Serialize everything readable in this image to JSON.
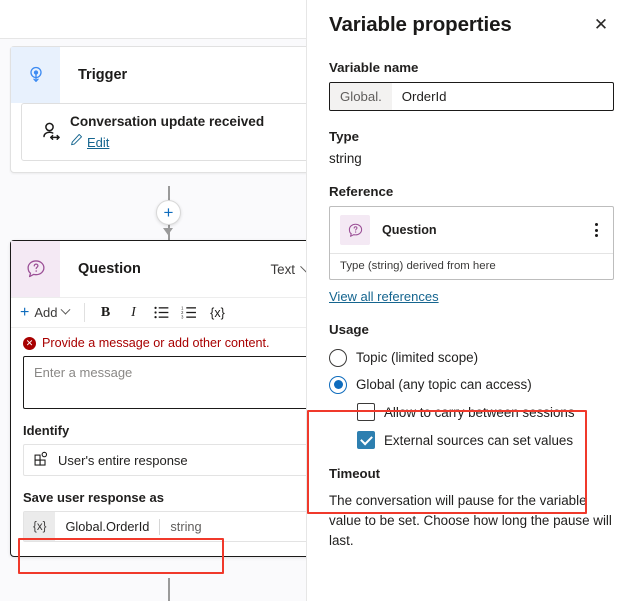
{
  "canvas": {
    "trigger_node": {
      "icon": "trigger-bolt-icon",
      "title": "Trigger",
      "item": {
        "icon": "conversation-update-icon",
        "title": "Conversation update received",
        "edit_icon": "pencil-icon",
        "edit_label": "Edit"
      }
    },
    "add_node_button": "+",
    "question_node": {
      "icon": "question-bubble-icon",
      "title": "Question",
      "type_selector": {
        "value": "Text",
        "chevron": "chevron-down-icon"
      },
      "toolbar": {
        "add_label": "Add",
        "add_plus_icon": "plus-icon",
        "add_chevron_icon": "chevron-down-icon",
        "bold": "B",
        "italic": "I",
        "bullet_list_icon": "bullet-list-icon",
        "numbered_list_icon": "numbered-list-icon",
        "variable_icon": "{x}"
      },
      "error": {
        "icon": "error-circle-icon",
        "text": "Provide a message or add other content."
      },
      "message_placeholder": "Enter a message",
      "identify_label": "Identify",
      "identify_value": "User's entire response",
      "identify_icon": "entity-grid-icon",
      "save_label": "Save user response as",
      "save_variable": {
        "badge": "{x}",
        "name": "Global.OrderId",
        "type": "string"
      }
    }
  },
  "panel": {
    "title": "Variable properties",
    "close_icon": "close-icon",
    "variable_name_label": "Variable name",
    "variable_name_prefix": "Global.",
    "variable_name_value": "OrderId",
    "type_label": "Type",
    "type_value": "string",
    "reference_label": "Reference",
    "reference_card": {
      "icon": "question-bubble-icon",
      "name": "Question",
      "kebab_icon": "more-vertical-icon",
      "note": "Type (string) derived from here"
    },
    "view_all_references": "View all references",
    "usage_label": "Usage",
    "usage_options": [
      {
        "label": "Topic (limited scope)",
        "selected": false
      },
      {
        "label": "Global (any topic can access)",
        "selected": true
      }
    ],
    "usage_sub_options": [
      {
        "label": "Allow to carry between sessions",
        "checked": false
      },
      {
        "label": "External sources can set values",
        "checked": true
      }
    ],
    "timeout_label": "Timeout",
    "timeout_desc": "The conversation will pause for the variable value to be set. Choose how long the pause will last."
  },
  "colors": {
    "highlight": "#f0392b",
    "accent_blue": "#0f6cbd",
    "link": "#15658f",
    "error_red": "#a80000",
    "checkbox_blue": "#2d7fb0"
  }
}
